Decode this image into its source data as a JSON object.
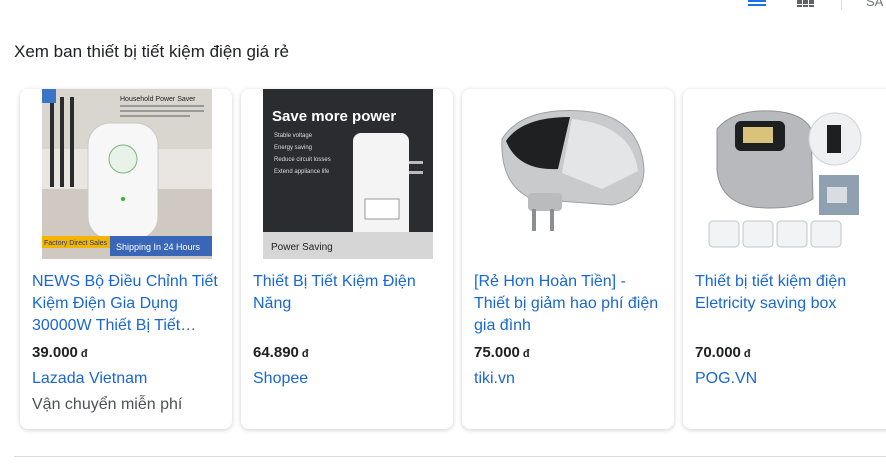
{
  "heading": "Xem ban thiết bị tiết kiệm điện giá rẻ",
  "topbar": {
    "sa_text": "SA"
  },
  "products": [
    {
      "title_lines": [
        "NEWS Bộ Điều Chỉnh Tiết",
        "Kiệm Điện Gia Dụng",
        "30000W Thiết Bị Tiết…"
      ],
      "price": "39.000",
      "currency": "đ",
      "store": "Lazada Vietnam",
      "shipping": "Vận chuyển miễn phí",
      "image_texts": {
        "header": "Household Power Saver",
        "badge_left": "Factory Direct Sales",
        "badge_right": "Shipping In 24 Hours"
      }
    },
    {
      "title_lines": [
        "Thiết Bị Tiết Kiệm Điện",
        "Năng"
      ],
      "price": "64.890",
      "currency": "đ",
      "store": "Shopee",
      "image_texts": {
        "headline": "Save more power",
        "features": [
          "Stable voltage",
          "Energy saving",
          "Reduce circuit losses",
          "Extend appliance life"
        ],
        "footer": "Power Saving"
      }
    },
    {
      "title_lines": [
        "[Rẻ Hơn Hoàn Tiền] -",
        "Thiết bị giảm hao phí điện",
        "gia đình"
      ],
      "price": "75.000",
      "currency": "đ",
      "store": "tiki.vn"
    },
    {
      "title_lines": [
        "Thiết bị tiết kiệm điện",
        "Eletricity saving box"
      ],
      "price": "70.000",
      "currency": "đ",
      "store": "POG.VN"
    }
  ]
}
